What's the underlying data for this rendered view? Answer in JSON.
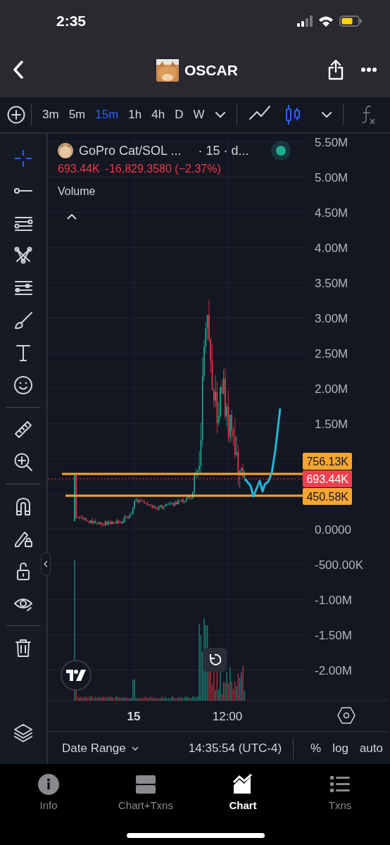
{
  "status_bar": {
    "time": "2:35"
  },
  "header": {
    "title": "OSCAR"
  },
  "intervals": [
    {
      "label": "3m",
      "selected": false
    },
    {
      "label": "5m",
      "selected": false
    },
    {
      "label": "15m",
      "selected": true
    },
    {
      "label": "1h",
      "selected": false
    },
    {
      "label": "4h",
      "selected": false
    },
    {
      "label": "D",
      "selected": false
    },
    {
      "label": "W",
      "selected": false
    }
  ],
  "chart_styles": [
    {
      "kind": "line",
      "selected": false
    },
    {
      "kind": "candles",
      "selected": true
    }
  ],
  "legend": {
    "symbol": "GoPro Cat/SOL ...",
    "details": "· 15 · d...",
    "last": "693.44K",
    "change": "-16,829.3580 (−2.37%)",
    "indicator": "Volume",
    "live": true
  },
  "price_axis": {
    "labels": [
      "5.50M",
      "5.00M",
      "4.50M",
      "4.00M",
      "3.50M",
      "3.00M",
      "2.50M",
      "2.00M",
      "1.50M",
      "0.0000",
      "-500.00K",
      "-1.00M",
      "-1.50M",
      "-2.00M"
    ]
  },
  "price_tags": [
    {
      "label": "756.13K",
      "color": "#f7a531"
    },
    {
      "label": "693.44K",
      "color": "#f0404f"
    },
    {
      "label": "450.58K",
      "color": "#f7a531"
    }
  ],
  "time_axis": {
    "labels": [
      "15",
      "12:00"
    ]
  },
  "bottom_bar": {
    "date_range": "Date Range",
    "time": "14:35:54 (UTC-4)",
    "options": [
      "%",
      "log",
      "auto"
    ]
  },
  "tabs": [
    {
      "label": "Info",
      "kind": "info",
      "selected": false
    },
    {
      "label": "Chart+Txns",
      "kind": "split",
      "selected": false
    },
    {
      "label": "Chart",
      "kind": "chart",
      "selected": true
    },
    {
      "label": "Txns",
      "kind": "list",
      "selected": false
    }
  ]
}
